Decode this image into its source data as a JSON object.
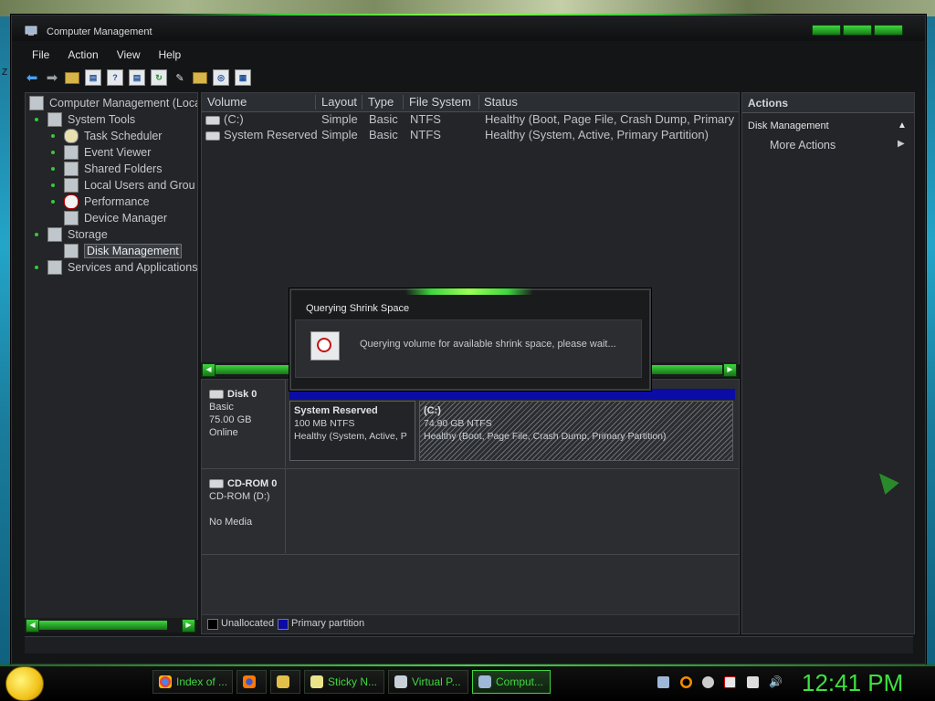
{
  "window": {
    "title": "Computer Management"
  },
  "menu": [
    "File",
    "Action",
    "View",
    "Help"
  ],
  "tree": {
    "root": "Computer Management (Local",
    "system_tools": "System Tools",
    "task_scheduler": "Task Scheduler",
    "event_viewer": "Event Viewer",
    "shared_folders": "Shared Folders",
    "local_users": "Local Users and Grou",
    "performance": "Performance",
    "device_manager": "Device Manager",
    "storage": "Storage",
    "disk_management": "Disk Management",
    "services": "Services and Applications"
  },
  "volumes": {
    "headers": [
      "Volume",
      "Layout",
      "Type",
      "File System",
      "Status"
    ],
    "rows": [
      {
        "volume": "(C:)",
        "layout": "Simple",
        "type": "Basic",
        "fs": "NTFS",
        "status": "Healthy (Boot, Page File, Crash Dump, Primary"
      },
      {
        "volume": "System Reserved",
        "layout": "Simple",
        "type": "Basic",
        "fs": "NTFS",
        "status": "Healthy (System, Active, Primary Partition)"
      }
    ]
  },
  "disks": {
    "disk0": {
      "name": "Disk 0",
      "type": "Basic",
      "size": "75.00 GB",
      "state": "Online"
    },
    "cdrom0": {
      "name": "CD-ROM 0",
      "type": "CD-ROM (D:)",
      "state": "No Media"
    },
    "partitions": {
      "sys": {
        "title": "System Reserved",
        "size": "100 MB NTFS",
        "status": "Healthy (System, Active, P"
      },
      "c": {
        "title": "(C:)",
        "size": "74.90 GB NTFS",
        "status": "Healthy (Boot, Page File, Crash Dump, Primary Partition)"
      }
    }
  },
  "legend": {
    "unallocated": "Unallocated",
    "primary": "Primary partition",
    "unallocated_color": "#000000",
    "primary_color": "#0b0ba6"
  },
  "actions": {
    "header": "Actions",
    "section": "Disk Management",
    "more": "More Actions"
  },
  "dialog": {
    "title": "Querying Shrink Space",
    "message": "Querying volume for available shrink space, please wait..."
  },
  "taskbar": {
    "tasks": [
      "Index of ...",
      "",
      "",
      "Sticky N...",
      "Virtual P...",
      "Comput..."
    ],
    "clock": "12:41 PM"
  },
  "colors": {
    "accent": "#3fd63f",
    "window_bg": "#141517"
  }
}
